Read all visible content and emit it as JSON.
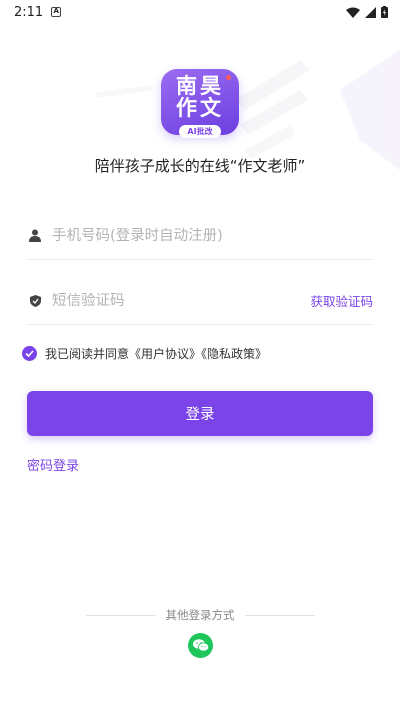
{
  "status_bar": {
    "time": "2:11",
    "notif_glyph": "A",
    "icons": [
      "wifi-icon",
      "signal-icon",
      "battery-charging-icon"
    ]
  },
  "logo": {
    "line1": "南昊",
    "line2": "作文",
    "badge": "AI批改"
  },
  "slogan": "陪伴孩子成长的在线“作文老师”",
  "form": {
    "phone_placeholder": "手机号码(登录时自动注册)",
    "code_placeholder": "短信验证码",
    "get_code_label": "获取验证码"
  },
  "agreement": {
    "checked": true,
    "text": "我已阅读并同意《用户协议》《隐私政策》"
  },
  "login_button": "登录",
  "password_login": "密码登录",
  "other_login": {
    "label": "其他登录方式",
    "methods": [
      "wechat-icon"
    ]
  },
  "colors": {
    "accent": "#7a44e8",
    "wechat": "#1ec65c"
  }
}
